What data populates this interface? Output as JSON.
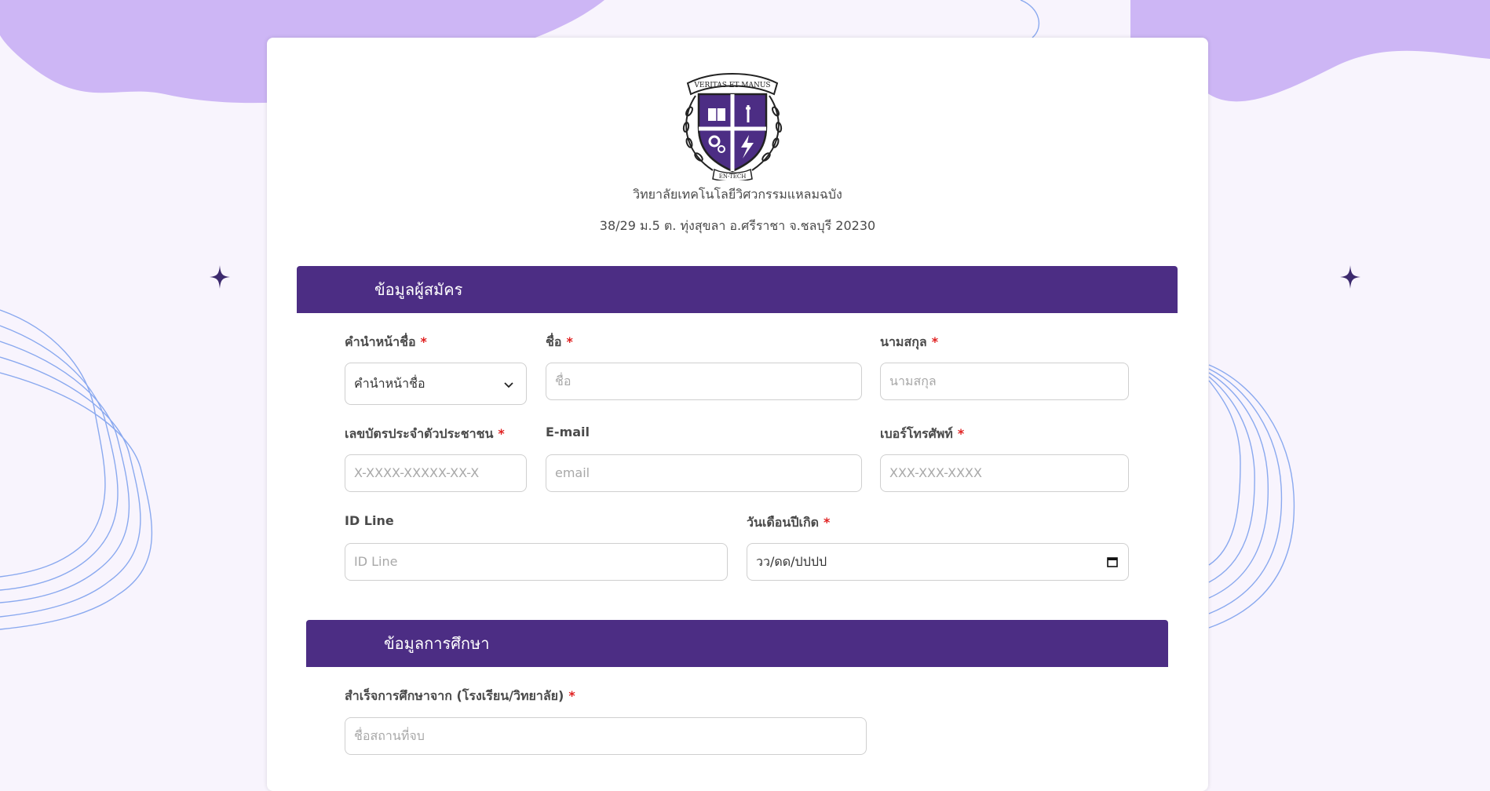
{
  "school": {
    "name": "วิทยาลัยเทคโนโลยีวิศวกรรมแหลมฉบัง",
    "address": "38/29 ม.5 ต. ทุ่งสุขลา อ.ศรีราชา จ.ชลบุรี 20230",
    "logo_motto": "VERITAS ET MANUS",
    "logo_ribbon": "EN-TECH"
  },
  "colors": {
    "accent": "#4c2d84",
    "background_blob": "#cdb6f5",
    "background_lines": "#8aa9ef",
    "required": "#e02020"
  },
  "sections": {
    "applicant": "ข้อมูลผู้สมัคร",
    "education": "ข้อมูลการศึกษา"
  },
  "form": {
    "title_prefix": {
      "label": "คำนำหน้าชื่อ",
      "required_mark": "*",
      "selected": "คำนำหน้าชื่อ"
    },
    "first_name": {
      "label": "ชื่อ",
      "required_mark": "*",
      "placeholder": "ชื่อ"
    },
    "last_name": {
      "label": "นามสกุล",
      "required_mark": "*",
      "placeholder": "นามสกุล"
    },
    "citizen_id": {
      "label": "เลขบัตรประจำตัวประชาชน",
      "required_mark": "*",
      "placeholder": "X-XXXX-XXXXX-XX-X"
    },
    "email": {
      "label": "E-mail",
      "placeholder": "email"
    },
    "phone": {
      "label": "เบอร์โทรศัพท์",
      "required_mark": "*",
      "placeholder": "XXX-XXX-XXXX"
    },
    "line_id": {
      "label": "ID Line",
      "placeholder": "ID Line"
    },
    "birthdate": {
      "label": "วันเดือนปีเกิด",
      "required_mark": "*",
      "value": "วว/ดด/ปปปป"
    },
    "graduated_from": {
      "label": "สำเร็จการศึกษาจาก (โรงเรียน/วิทยาลัย)",
      "required_mark": "*",
      "placeholder": "ชื่อสถานที่จบ"
    }
  },
  "icons": {
    "select": "chevron-down-icon",
    "date": "calendar-icon",
    "decor": "sparkle-icon"
  }
}
